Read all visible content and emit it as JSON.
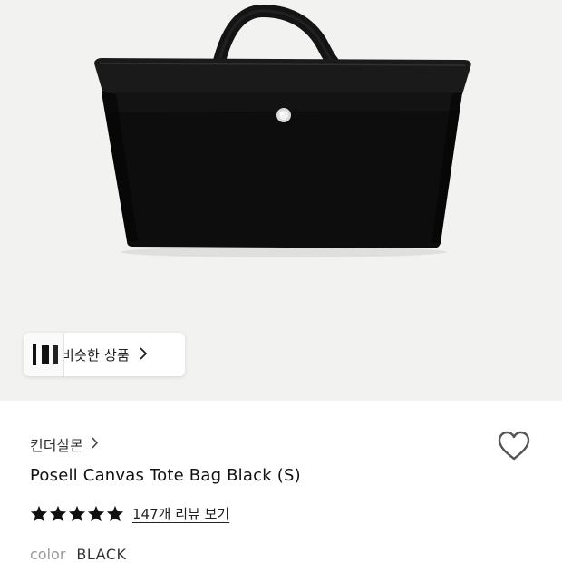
{
  "product_image": {
    "background_color": "#f2f2f0",
    "subject": "black canvas tote bag with leather trim and handles"
  },
  "similar_products": {
    "label": "비슷한 상품",
    "chevron_icon": "chevron-right-icon"
  },
  "brand": {
    "name": "킨더살몬",
    "chevron_icon": "chevron-right-icon"
  },
  "product": {
    "name": "Posell Canvas Tote Bag Black (S)"
  },
  "rating": {
    "stars": 5,
    "max_stars": 5,
    "star_color": "#111111",
    "review_link": "147개 리뷰 보기"
  },
  "option": {
    "label": "color",
    "value": "BLACK"
  },
  "wishlist": {
    "icon": "heart-outline-icon"
  }
}
